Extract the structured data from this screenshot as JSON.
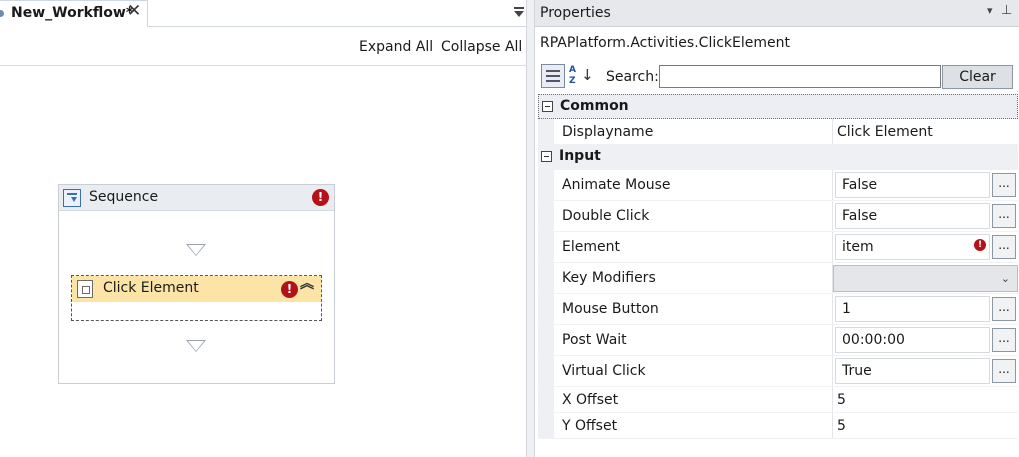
{
  "designer": {
    "tab_title": "New_Workflow*",
    "tab_close": "✕",
    "expand_all": "Expand All",
    "collapse_all": "Collapse All",
    "sequence": {
      "title": "Sequence",
      "error_mark": "!",
      "activity": {
        "title": "Click Element",
        "error_mark": "!",
        "collapse_glyph": "︽"
      }
    }
  },
  "properties": {
    "title": "Properties",
    "pin_glyph": "▾",
    "pin_icon": "⊥",
    "activity_type": "RPAPlatform.Activities.ClickElement",
    "toolbar": {
      "search_label": "Search:",
      "search_value": "",
      "clear_label": "Clear"
    },
    "categories": {
      "common": "Common",
      "input": "Input"
    },
    "common_rows": [
      {
        "name": "Displayname",
        "value": "Click Element"
      }
    ],
    "input_rows": [
      {
        "name": "Animate Mouse",
        "value": "False"
      },
      {
        "name": "Double Click",
        "value": "False"
      },
      {
        "name": "Element",
        "value": "item",
        "error": "!"
      },
      {
        "name": "Key Modifiers",
        "value": ""
      },
      {
        "name": "Mouse Button",
        "value": "1"
      },
      {
        "name": "Post Wait",
        "value": "00:00:00"
      },
      {
        "name": "Virtual Click",
        "value": "True"
      },
      {
        "name": "X Offset",
        "value": "5"
      },
      {
        "name": "Y Offset",
        "value": "5"
      }
    ],
    "ellipsis": "..."
  }
}
